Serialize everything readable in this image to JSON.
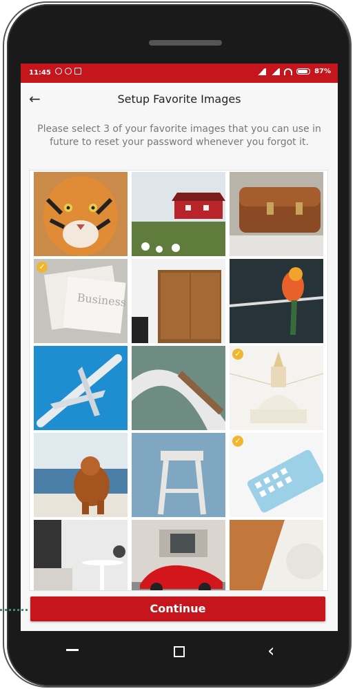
{
  "status": {
    "time": "11:45",
    "battery": "87%"
  },
  "header": {
    "title": "Setup Favorite Images"
  },
  "description": "Please select 3 of your favorite images that you can use in future to reset your password whenever you forgot it.",
  "images": [
    {
      "name": "tiger",
      "selected": false
    },
    {
      "name": "red-house",
      "selected": false
    },
    {
      "name": "leather-bag",
      "selected": false
    },
    {
      "name": "newspaper",
      "selected": true
    },
    {
      "name": "wardrobe",
      "selected": false
    },
    {
      "name": "parrot",
      "selected": false
    },
    {
      "name": "airplane",
      "selected": false
    },
    {
      "name": "bridge",
      "selected": false
    },
    {
      "name": "stupa",
      "selected": true
    },
    {
      "name": "dog-beach",
      "selected": false
    },
    {
      "name": "stool",
      "selected": false
    },
    {
      "name": "smartphone",
      "selected": true
    },
    {
      "name": "bedroom",
      "selected": false
    },
    {
      "name": "red-car",
      "selected": false
    },
    {
      "name": "abstract-wood",
      "selected": false
    }
  ],
  "continue_label": "Continue",
  "colors": {
    "brand": "#c4161c",
    "check": "#f0b62d"
  }
}
